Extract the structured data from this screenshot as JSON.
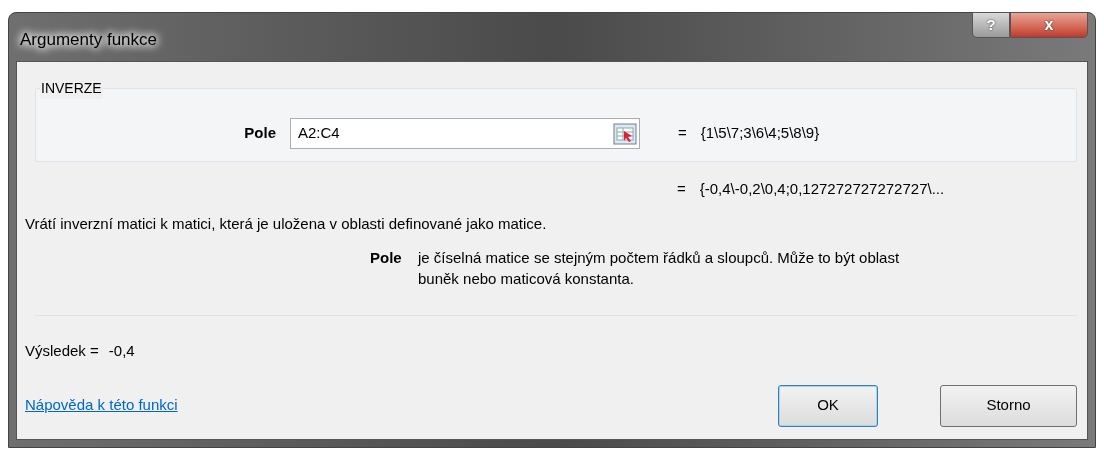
{
  "window": {
    "title": "Argumenty funkce",
    "help_button": "?",
    "close_button": "x"
  },
  "function_group": {
    "title": "INVERZE",
    "argument": {
      "label": "Pole",
      "value": "A2:C4",
      "equals": "=",
      "preview": "{1\\5\\7;3\\6\\4;5\\8\\9}"
    }
  },
  "result_preview": {
    "equals": "=",
    "value": "{-0,4\\-0,2\\0,4;0,127272727272727\\..."
  },
  "description": "Vrátí inverzní matici k matici, která je uložena v oblasti definované jako matice.",
  "argument_help": {
    "name": "Pole",
    "text": "je číselná matice se stejným počtem řádků a sloupců. Může to být oblast buněk nebo maticová konstanta."
  },
  "result": {
    "label": "Výsledek =",
    "value": "-0,4"
  },
  "help_link": "Nápověda k této funkci",
  "buttons": [
    {
      "label": "OK",
      "default": true
    },
    {
      "label": "Storno",
      "default": false
    }
  ]
}
